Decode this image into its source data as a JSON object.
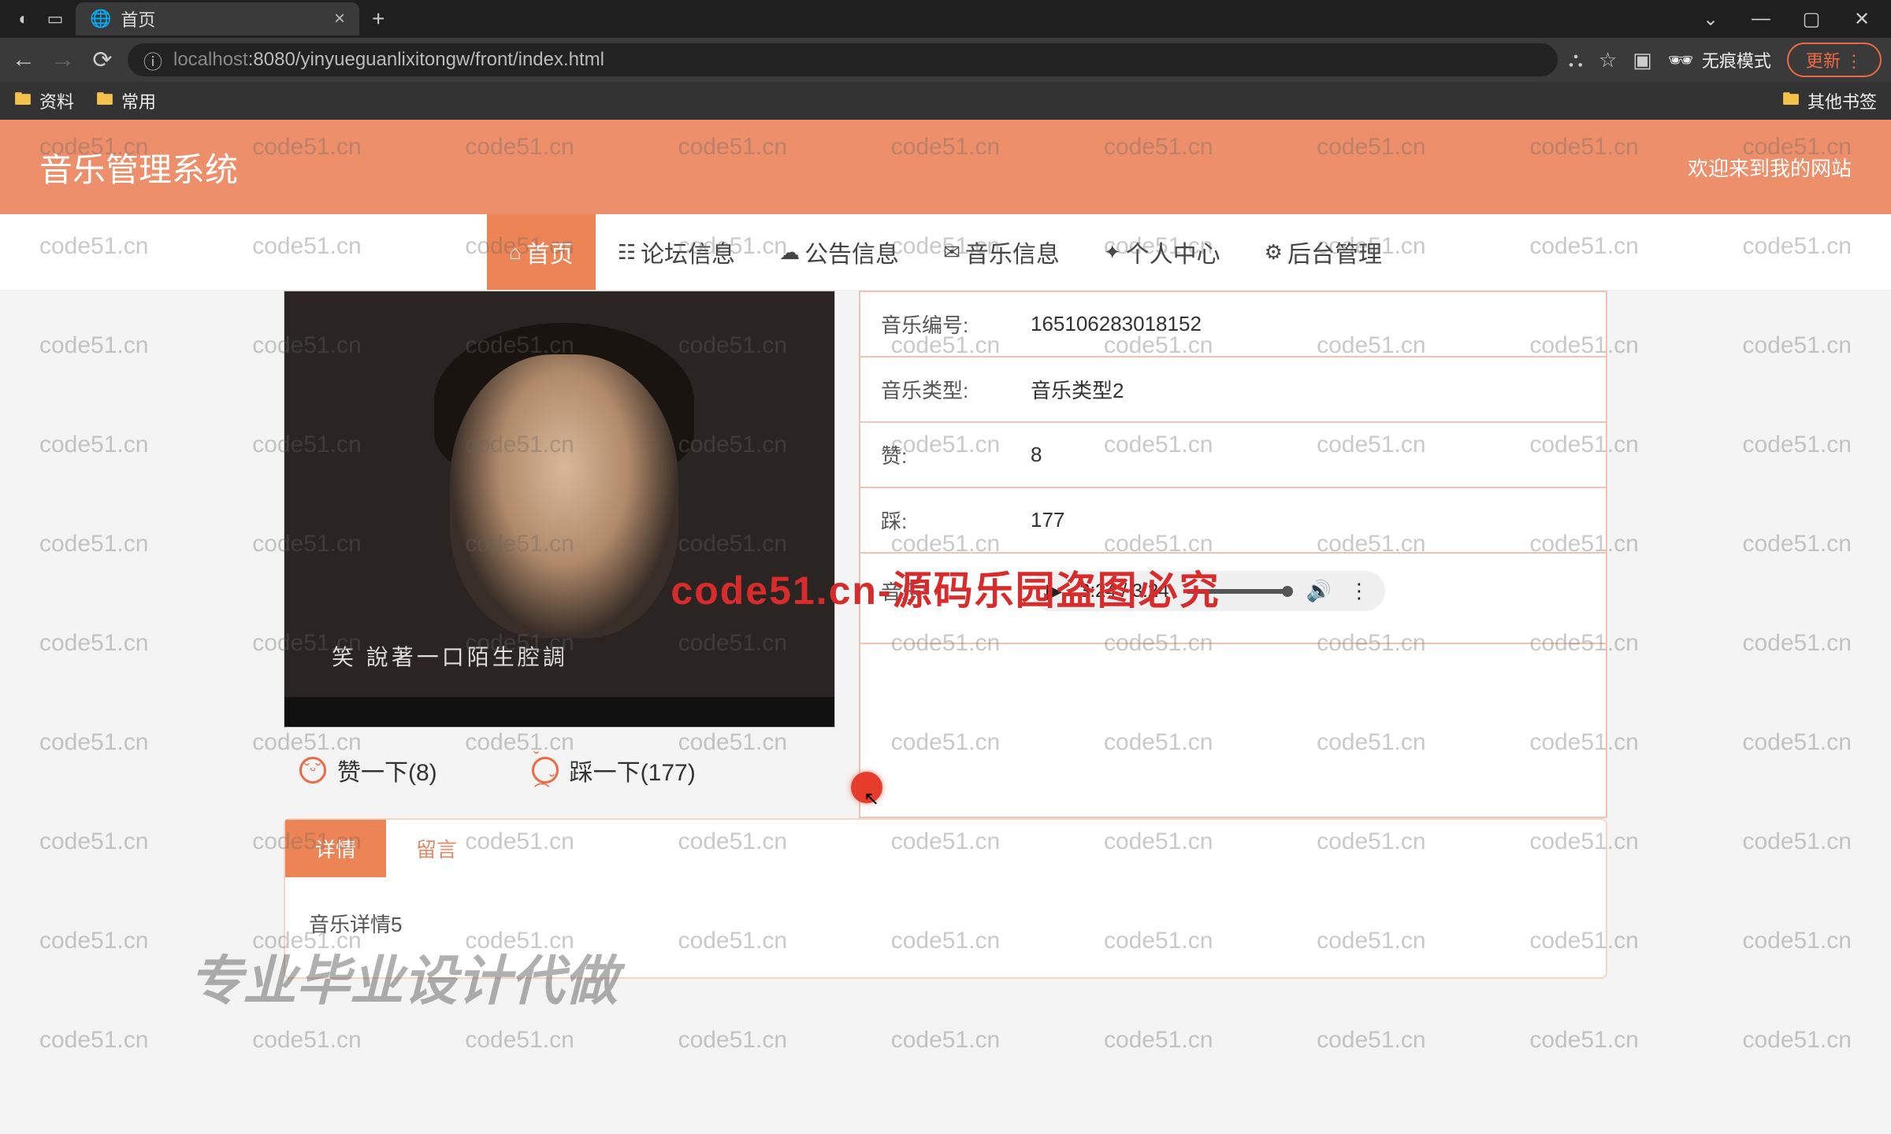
{
  "browser": {
    "tab_title": "首页",
    "url_proto": "localhost",
    "url_rest": ":8080/yinyueguanlixitongw/front/index.html",
    "incognito_label": "无痕模式",
    "update_label": "更新"
  },
  "bookmarks": {
    "b1": "资料",
    "b2": "常用",
    "other": "其他书签"
  },
  "header": {
    "title": "音乐管理系统",
    "welcome": "欢迎来到我的网站"
  },
  "nav": {
    "items": [
      {
        "icon": "⌂",
        "label": "首页"
      },
      {
        "icon": "☷",
        "label": "论坛信息"
      },
      {
        "icon": "☁",
        "label": "公告信息"
      },
      {
        "icon": "✉",
        "label": "音乐信息"
      },
      {
        "icon": "✦",
        "label": "个人中心"
      },
      {
        "icon": "⚙",
        "label": "后台管理"
      }
    ]
  },
  "cover": {
    "subtitle": "笑 說著一口陌生腔調"
  },
  "vote": {
    "like_label": "赞一下(8)",
    "dislike_label": "踩一下(177)"
  },
  "info": {
    "rows": [
      {
        "label": "音乐编号:",
        "value": "165106283018152"
      },
      {
        "label": "音乐类型:",
        "value": "音乐类型2"
      },
      {
        "label": "赞:",
        "value": "8"
      },
      {
        "label": "踩:",
        "value": "177"
      }
    ],
    "audio_label": "音乐:",
    "audio_time": "3:24 / 3:24"
  },
  "detail": {
    "tab1": "详情",
    "tab2": "留言",
    "body": "音乐详情5"
  },
  "watermark": {
    "text": "code51.cn",
    "center": "code51.cn-源码乐园盗图必究",
    "big": "专业毕业设计代做"
  }
}
